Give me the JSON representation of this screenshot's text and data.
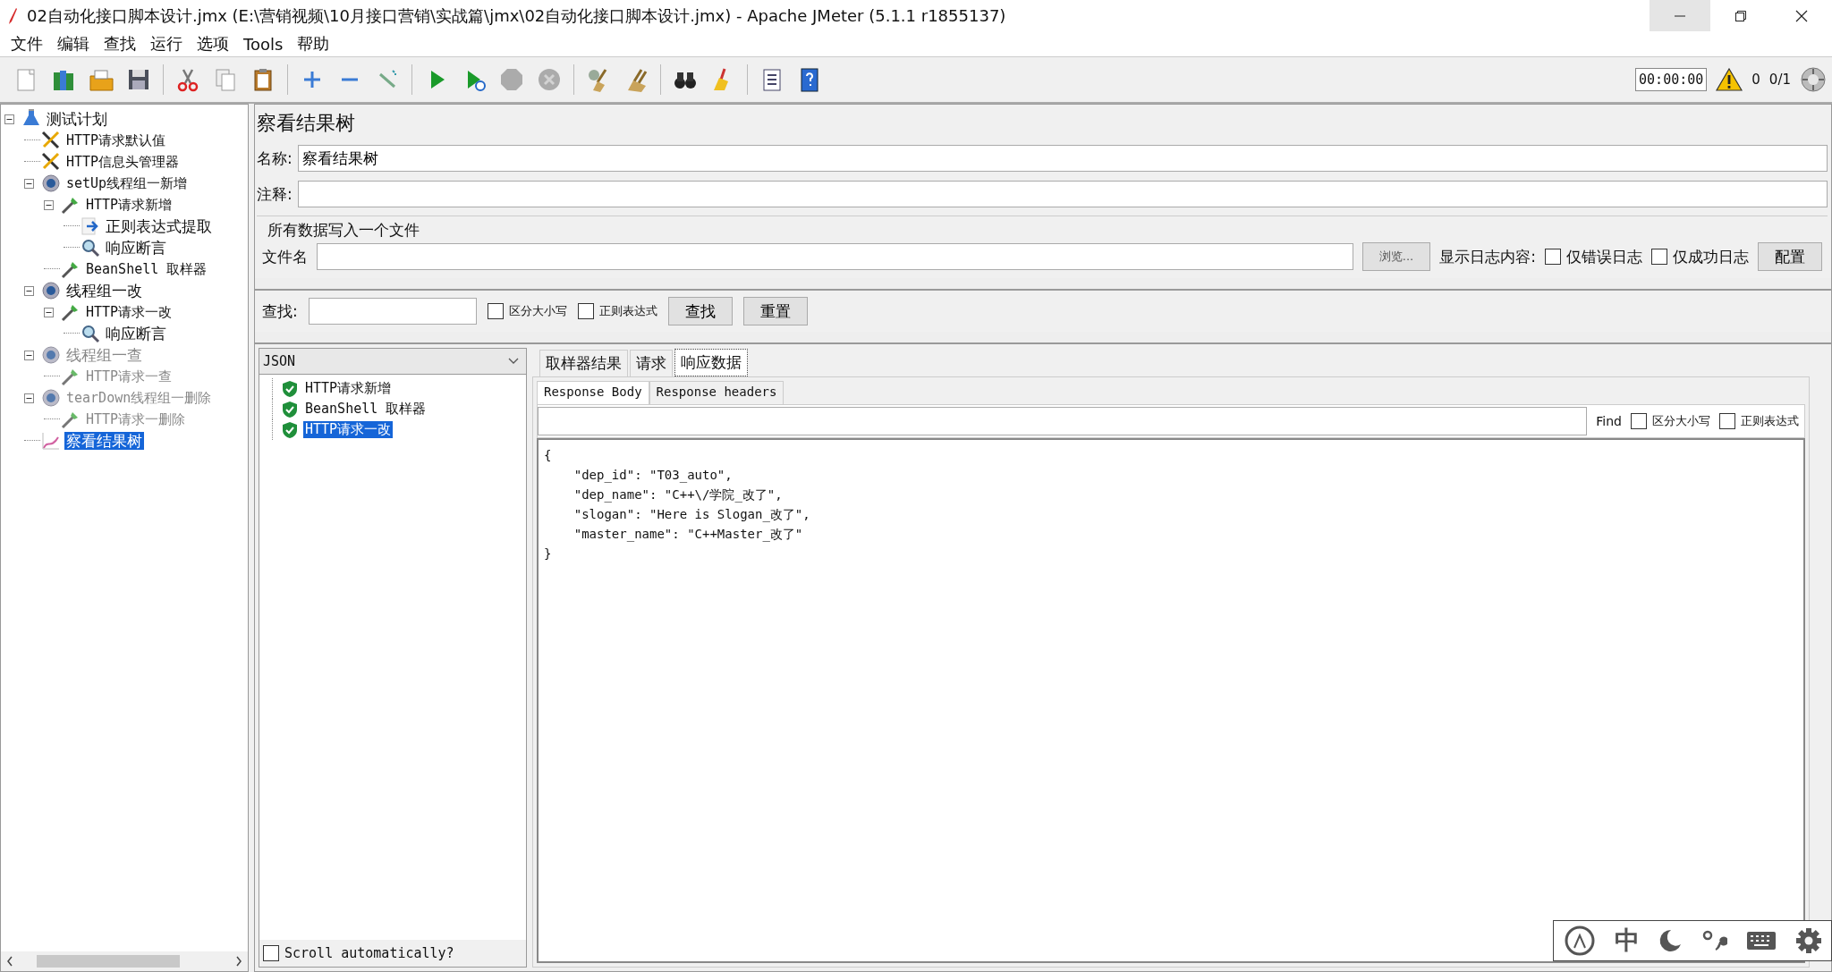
{
  "window": {
    "title": "02自动化接口脚本设计.jmx (E:\\营销视频\\10月接口营销\\实战篇\\jmx\\02自动化接口脚本设计.jmx) - Apache JMeter (5.1.1 r1855137)"
  },
  "menu": [
    "文件",
    "编辑",
    "查找",
    "运行",
    "选项",
    "Tools",
    "帮助"
  ],
  "toolbar": [
    [
      {
        "kind": "new",
        "disabled": false
      },
      {
        "kind": "templates",
        "disabled": false
      },
      {
        "kind": "open",
        "disabled": false
      },
      {
        "kind": "save",
        "disabled": false
      }
    ],
    [
      {
        "kind": "cut",
        "disabled": false
      },
      {
        "kind": "copy",
        "disabled": false
      },
      {
        "kind": "paste",
        "disabled": false
      }
    ],
    [
      {
        "kind": "expand",
        "disabled": false
      },
      {
        "kind": "collapse",
        "disabled": false
      },
      {
        "kind": "toggle",
        "disabled": false
      }
    ],
    [
      {
        "kind": "start",
        "disabled": false
      },
      {
        "kind": "start-no-pause",
        "disabled": false
      },
      {
        "kind": "stop",
        "disabled": true
      },
      {
        "kind": "shutdown",
        "disabled": true
      }
    ],
    [
      {
        "kind": "clear",
        "disabled": false
      },
      {
        "kind": "clear-all",
        "disabled": false
      }
    ],
    [
      {
        "kind": "search",
        "disabled": false
      },
      {
        "kind": "reset-search",
        "disabled": false
      }
    ],
    [
      {
        "kind": "function-helper",
        "disabled": false
      },
      {
        "kind": "help",
        "disabled": false
      }
    ]
  ],
  "status": {
    "timer": "00:00:00",
    "warnings": "0",
    "threads": "0/1"
  },
  "tree": [
    {
      "label": "测试计划",
      "kind": "plan",
      "expanded": true,
      "disabled": false,
      "selected": false,
      "children": [
        {
          "label": "HTTP请求默认值",
          "kind": "config",
          "disabled": false,
          "selected": false
        },
        {
          "label": "HTTP信息头管理器",
          "kind": "config",
          "disabled": false,
          "selected": false
        },
        {
          "label": "setUp线程组一新增",
          "kind": "thread-group",
          "expanded": true,
          "disabled": false,
          "selected": false,
          "children": [
            {
              "label": "HTTP请求新增",
              "kind": "sampler",
              "expanded": true,
              "disabled": false,
              "selected": false,
              "children": [
                {
                  "label": "正则表达式提取",
                  "kind": "extractor",
                  "disabled": false,
                  "selected": false
                },
                {
                  "label": "响应断言",
                  "kind": "assertion",
                  "disabled": false,
                  "selected": false
                }
              ]
            },
            {
              "label": "BeanShell 取样器",
              "kind": "sampler",
              "disabled": false,
              "selected": false
            }
          ]
        },
        {
          "label": "线程组一改",
          "kind": "thread-group",
          "expanded": true,
          "disabled": false,
          "selected": false,
          "children": [
            {
              "label": "HTTP请求一改",
              "kind": "sampler",
              "expanded": true,
              "disabled": false,
              "selected": false,
              "children": [
                {
                  "label": "响应断言",
                  "kind": "assertion",
                  "disabled": false,
                  "selected": false
                }
              ]
            }
          ]
        },
        {
          "label": "线程组一查",
          "kind": "thread-group",
          "expanded": true,
          "disabled": true,
          "selected": false,
          "children": [
            {
              "label": "HTTP请求一查",
              "kind": "sampler",
              "disabled": true,
              "selected": false
            }
          ]
        },
        {
          "label": "tearDown线程组一删除",
          "kind": "thread-group",
          "expanded": true,
          "disabled": true,
          "selected": false,
          "children": [
            {
              "label": "HTTP请求一删除",
              "kind": "sampler",
              "disabled": true,
              "selected": false
            }
          ]
        },
        {
          "label": "察看结果树",
          "kind": "listener",
          "disabled": false,
          "selected": true
        }
      ]
    }
  ],
  "panel": {
    "title": "察看结果树",
    "name_label": "名称:",
    "name_value": "察看结果树",
    "comment_label": "注释:",
    "file_group": {
      "title": "所有数据写入一个文件",
      "file_label": "文件名",
      "browse": "浏览...",
      "log_label": "显示日志内容:",
      "options": [
        {
          "label": "仅错误日志",
          "checked": false
        },
        {
          "label": "仅成功日志",
          "checked": false
        }
      ],
      "configure": "配置"
    },
    "search": {
      "label": "查找:",
      "options": [
        {
          "label": "区分大小写",
          "checked": false
        },
        {
          "label": "正则表达式",
          "checked": false
        }
      ],
      "find": "查找",
      "reset": "重置"
    },
    "renderer": "JSON",
    "results": [
      {
        "label": "HTTP请求新增",
        "selected": false
      },
      {
        "label": "BeanShell 取样器",
        "selected": false
      },
      {
        "label": "HTTP请求一改",
        "selected": true
      }
    ],
    "scroll_auto": {
      "label": "Scroll automatically?",
      "checked": false
    },
    "tabs": [
      {
        "label": "取样器结果",
        "selected": false
      },
      {
        "label": "请求",
        "selected": false
      },
      {
        "label": "响应数据",
        "selected": true
      }
    ],
    "subtabs": [
      {
        "label": "Response Body",
        "selected": true
      },
      {
        "label": "Response headers",
        "selected": false
      }
    ],
    "find": {
      "label": "Find",
      "options": [
        {
          "label": "区分大小写",
          "checked": false
        },
        {
          "label": "正则表达式",
          "checked": false
        }
      ]
    },
    "body": [
      "{",
      "    \"dep_id\": \"T03_auto\",",
      "    \"dep_name\": \"C++\\/学院_改了\",",
      "    \"slogan\": \"Here is Slogan_改了\",",
      "    \"master_name\": \"C++Master_改了\"",
      "}"
    ]
  },
  "ime": {
    "mode": "中"
  }
}
